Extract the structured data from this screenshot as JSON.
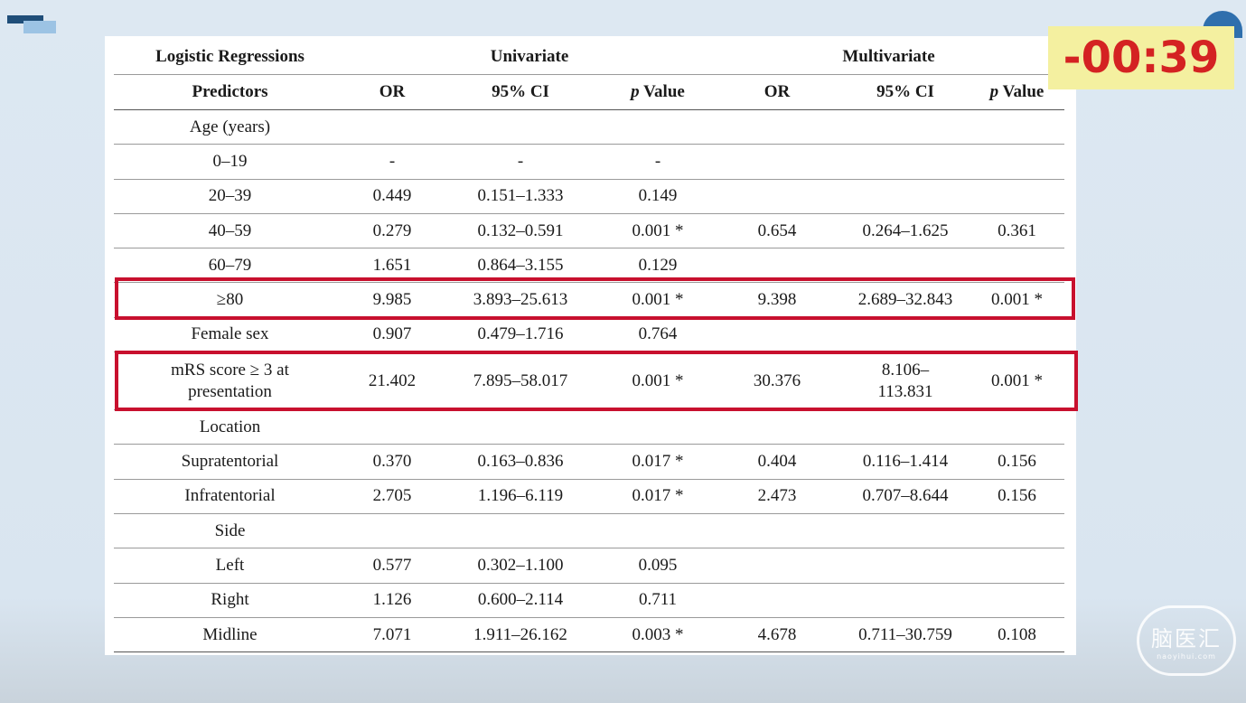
{
  "timer": "-00:39",
  "logo": {
    "main": "脑医汇",
    "sub": "naoyihui.com"
  },
  "table": {
    "header1": {
      "corner": "Logistic Regressions",
      "univariate": "Univariate",
      "multivariate": "Multivariate"
    },
    "header2": {
      "predictors": "Predictors",
      "or": "OR",
      "ci": "95% CI",
      "p_italic": "p",
      "p_rest": " Value"
    },
    "rows": [
      [
        "Age (years)",
        "",
        "",
        "",
        "",
        "",
        ""
      ],
      [
        "0–19",
        "-",
        "-",
        "-",
        "",
        "",
        ""
      ],
      [
        "20–39",
        "0.449",
        "0.151–1.333",
        "0.149",
        "",
        "",
        ""
      ],
      [
        "40–59",
        "0.279",
        "0.132–0.591",
        "0.001 *",
        "0.654",
        "0.264–1.625",
        "0.361"
      ],
      [
        "60–79",
        "1.651",
        "0.864–3.155",
        "0.129",
        "",
        "",
        ""
      ],
      [
        "≥80",
        "9.985",
        "3.893–25.613",
        "0.001 *",
        "9.398",
        "2.689–32.843",
        "0.001 *"
      ],
      [
        "Female sex",
        "0.907",
        "0.479–1.716",
        "0.764",
        "",
        "",
        ""
      ],
      [
        "mRS score ≥ 3 at presentation",
        "21.402",
        "7.895–58.017",
        "0.001 *",
        "30.376",
        "8.106–113.831",
        "0.001 *"
      ],
      [
        "Location",
        "",
        "",
        "",
        "",
        "",
        ""
      ],
      [
        "Supratentorial",
        "0.370",
        "0.163–0.836",
        "0.017 *",
        "0.404",
        "0.116–1.414",
        "0.156"
      ],
      [
        "Infratentorial",
        "2.705",
        "1.196–6.119",
        "0.017 *",
        "2.473",
        "0.707–8.644",
        "0.156"
      ],
      [
        "Side",
        "",
        "",
        "",
        "",
        "",
        ""
      ],
      [
        "Left",
        "0.577",
        "0.302–1.100",
        "0.095",
        "",
        "",
        ""
      ],
      [
        "Right",
        "1.126",
        "0.600–2.114",
        "0.711",
        "",
        "",
        ""
      ],
      [
        "Midline",
        "7.071",
        "1.911–26.162",
        "0.003 *",
        "4.678",
        "0.711–30.759",
        "0.108"
      ]
    ]
  },
  "highlight_color": "#c8102e",
  "timer_color": "#d42222"
}
